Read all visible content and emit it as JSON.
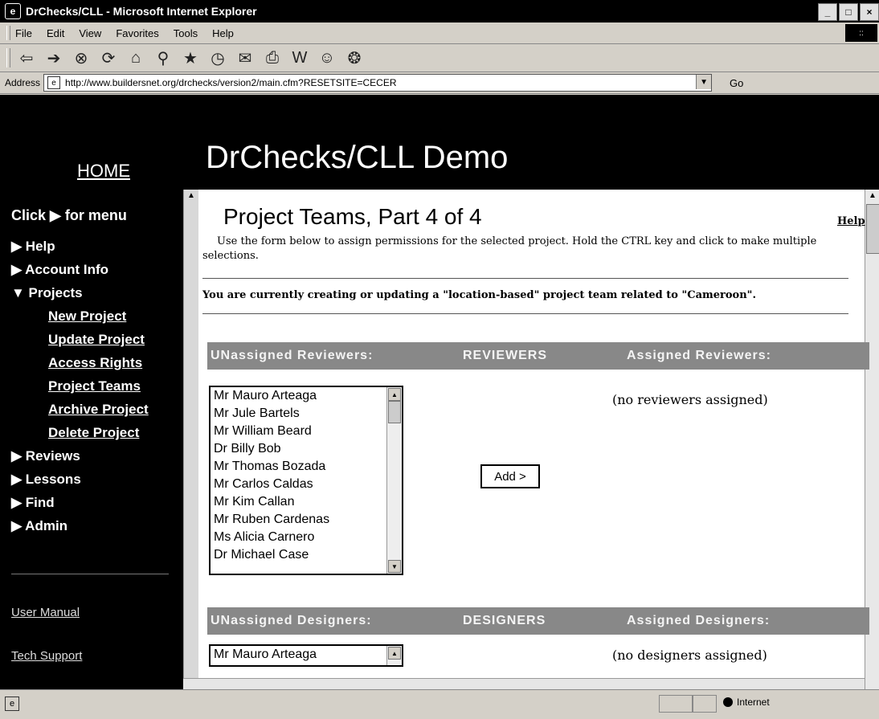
{
  "window": {
    "title": "DrChecks/CLL - Microsoft Internet Explorer",
    "controls": [
      "_",
      "□",
      "×"
    ]
  },
  "menu": [
    "File",
    "Edit",
    "View",
    "Favorites",
    "Tools",
    "Help"
  ],
  "toolbar_icons": [
    "back-icon",
    "forward-icon",
    "stop-icon",
    "refresh-icon",
    "home-icon",
    "search-icon",
    "favorites-icon",
    "history-icon",
    "mail-icon",
    "print-icon",
    "edit-icon",
    "discuss-icon",
    "messenger-icon"
  ],
  "address": {
    "label": "Address",
    "url": "http://www.buildersnet.org/drchecks/version2/main.cfm?RESETSITE=CECER",
    "go": "Go"
  },
  "header": {
    "home": "HOME",
    "title": "DrChecks/CLL Demo"
  },
  "sidebar": {
    "click_for_menu": "Click ▶ for menu",
    "items": [
      {
        "label": "▶ Help"
      },
      {
        "label": "▶ Account Info"
      },
      {
        "label": "▼ Projects"
      },
      {
        "label": "New Project"
      },
      {
        "label": "Update Project"
      },
      {
        "label": "Access Rights"
      },
      {
        "label": "Project Teams"
      },
      {
        "label": "Archive Project"
      },
      {
        "label": "Delete Project"
      },
      {
        "label": "▶ Reviews"
      },
      {
        "label": "▶ Lessons"
      },
      {
        "label": "▶ Find"
      },
      {
        "label": "▶ Admin"
      }
    ],
    "user_manual": "User Manual",
    "tech_support": "Tech Support"
  },
  "main": {
    "page_title": "Project Teams, Part 4 of 4",
    "help": "Help",
    "instructions": "Use the form below to assign permissions for the selected project. Hold the CTRL key and click to make multiple selections.",
    "status": "You are currently creating or updating a \"location-based\" project team related to \"Cameroon\".",
    "reviewers": {
      "unassigned": "UNassigned Reviewers:",
      "heading": "REVIEWERS",
      "assigned": "Assigned Reviewers:",
      "list": [
        "Mr Mauro Arteaga",
        "Mr Jule Bartels",
        "Mr William Beard",
        "Dr Billy Bob",
        "Mr Thomas Bozada",
        "Mr Carlos Caldas",
        "Mr Kim Callan",
        "Mr Ruben Cardenas",
        "Ms Alicia Carnero",
        "Dr Michael Case"
      ],
      "add_button": "Add >",
      "none_assigned": "(no reviewers assigned)"
    },
    "designers": {
      "unassigned": "UNassigned Designers:",
      "heading": "DESIGNERS",
      "assigned": "Assigned Designers:",
      "first_visible": "Mr Mauro Arteaga",
      "none_assigned": "(no designers assigned)"
    }
  },
  "statusbar": {
    "zone": "Internet"
  }
}
